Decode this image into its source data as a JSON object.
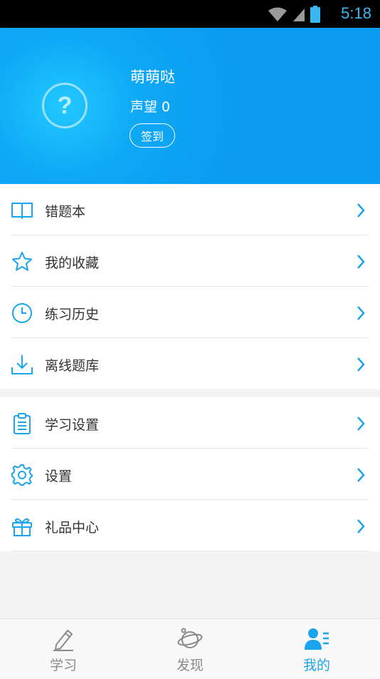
{
  "status_bar": {
    "time": "5:18"
  },
  "profile": {
    "avatar_placeholder": "?",
    "username": "萌萌哒",
    "reputation": "声望 0",
    "checkin_label": "签到"
  },
  "menu_group_1": [
    {
      "label": "错题本",
      "icon": "book-icon"
    },
    {
      "label": "我的收藏",
      "icon": "star-icon"
    },
    {
      "label": "练习历史",
      "icon": "clock-icon"
    },
    {
      "label": "离线题库",
      "icon": "download-icon"
    }
  ],
  "menu_group_2": [
    {
      "label": "学习设置",
      "icon": "clipboard-icon"
    },
    {
      "label": "设置",
      "icon": "gear-icon"
    },
    {
      "label": "礼品中心",
      "icon": "gift-icon"
    }
  ],
  "tabs": [
    {
      "label": "学习",
      "icon": "pencil-icon",
      "active": false
    },
    {
      "label": "发现",
      "icon": "planet-icon",
      "active": false
    },
    {
      "label": "我的",
      "icon": "profile-icon",
      "active": true
    }
  ],
  "colors": {
    "accent": "#1aa4ee",
    "header": "#0ea8f6",
    "inactive": "#8a8a8a"
  }
}
